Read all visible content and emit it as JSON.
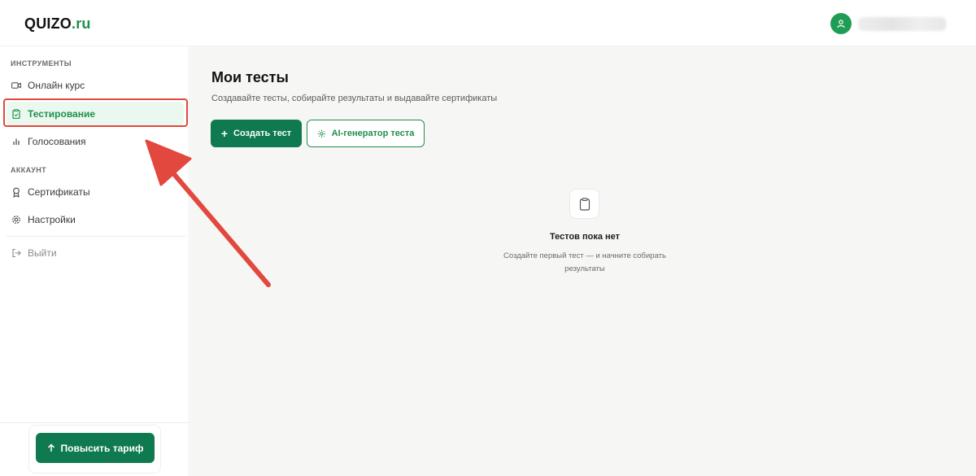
{
  "header": {
    "logo_main": "QUIZO",
    "logo_accent": ".ru",
    "user_name": "user"
  },
  "sidebar": {
    "tools_title": "ИНСТРУМЕНТЫ",
    "account_title": "АККАУНТ",
    "items": [
      {
        "label": "Онлайн курс",
        "icon": "video-icon"
      },
      {
        "label": "Тестирование",
        "icon": "clipboard-icon",
        "active": true
      },
      {
        "label": "Голосования",
        "icon": "bar-chart-icon"
      },
      {
        "label": "Сертификаты",
        "icon": "award-icon"
      },
      {
        "label": "Настройки",
        "icon": "gear-icon"
      },
      {
        "label": "Выйти",
        "icon": "logout-icon"
      }
    ],
    "upgrade_label": "Повысить тариф"
  },
  "main": {
    "title": "Мои тесты",
    "subtitle": "Создавайте тесты, собирайте результаты и выдавайте сертификаты",
    "create_label": "Создать тест",
    "ai_label": "AI-генератор теста",
    "empty_title": "Тестов пока нет",
    "empty_text": "Создайте первый тест — и начните собирать результаты"
  },
  "colors": {
    "brand": "#0f7a4f",
    "accent": "#1f8f4e",
    "active_bg": "#ebf8ef",
    "annotation": "#e2483d"
  }
}
